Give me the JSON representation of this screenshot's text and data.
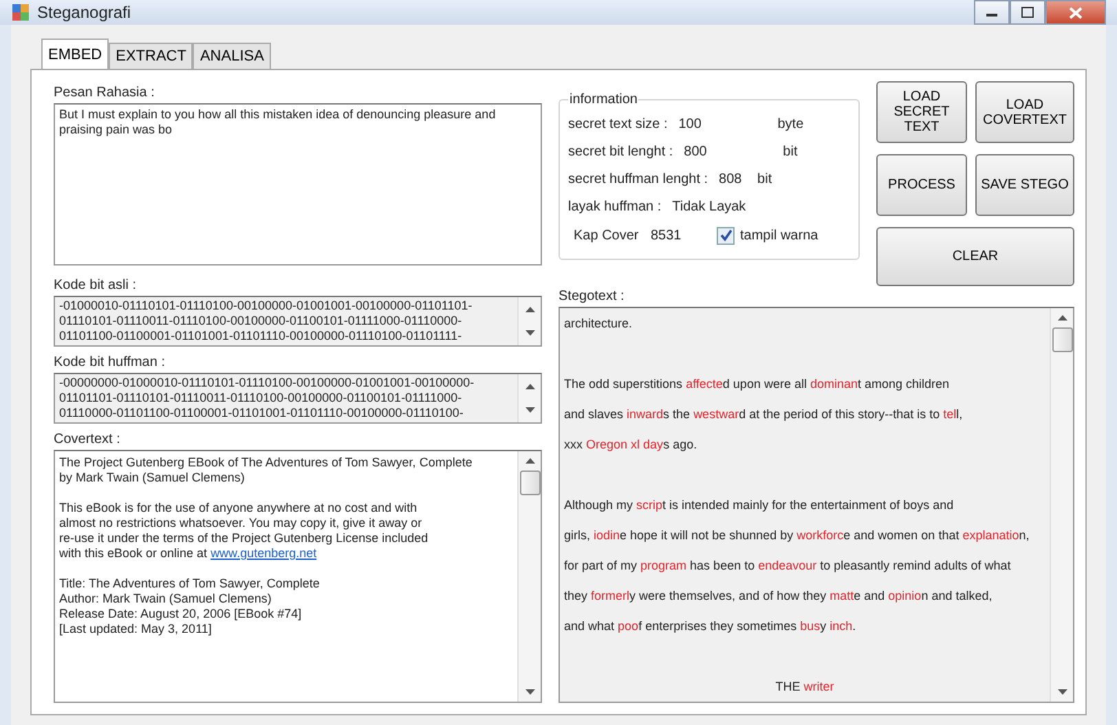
{
  "window": {
    "title": "Steganografi"
  },
  "tabs": [
    {
      "label": "EMBED",
      "selected": true
    },
    {
      "label": "EXTRACT",
      "selected": false
    },
    {
      "label": "ANALISA",
      "selected": false
    }
  ],
  "secret_message": {
    "label": "Pesan Rahasia :",
    "value": "But I must explain to you how all this mistaken idea of denouncing pleasure and praising pain was bo"
  },
  "original_bits": {
    "label": "Kode bit asli :",
    "lines": [
      "-01000010-01110101-01110100-00100000-01001001-00100000-01101101-",
      "01110101-01110011-01110100-00100000-01100101-01111000-01110000-",
      "01101100-01100001-01101001-01101110-00100000-01110100-01101111-"
    ]
  },
  "huffman_bits": {
    "label": "Kode bit huffman :",
    "lines": [
      "-00000000-01000010-01110101-01110100-00100000-01001001-00100000-",
      "01101101-01110101-01110011-01110100-00100000-01100101-01111000-",
      "01110000-01101100-01100001-01101001-01101110-00100000-01110100-"
    ]
  },
  "covertext": {
    "label": "Covertext :",
    "lines": [
      {
        "text": "The Project Gutenberg EBook of The Adventures of Tom Sawyer, Complete",
        "blank_before": false
      },
      {
        "text": "by Mark Twain (Samuel Clemens)",
        "blank_before": false
      },
      {
        "text": "This eBook is for the use of anyone anywhere at no cost and with",
        "blank_before": true
      },
      {
        "text": "almost no restrictions whatsoever.  You may copy it, give it away or",
        "blank_before": false
      },
      {
        "text": "re-use it under the terms of the Project Gutenberg License included",
        "blank_before": false
      },
      {
        "text": "with this eBook or online at ",
        "link": "www.gutenberg.net",
        "blank_before": false
      },
      {
        "text": "Title: The Adventures of Tom Sawyer, Complete",
        "blank_before": true
      },
      {
        "text": "Author: Mark Twain (Samuel Clemens)",
        "blank_before": false
      },
      {
        "text": "Release Date: August 20, 2006 [EBook #74]",
        "blank_before": false
      },
      {
        "text": "[Last updated: May 3, 2011]",
        "blank_before": false
      }
    ]
  },
  "information": {
    "title": "information",
    "rows": [
      {
        "label": "secret text size :",
        "value": "100",
        "unit": "byte"
      },
      {
        "label": "secret bit lenght :",
        "value": "800",
        "unit": "bit"
      },
      {
        "label": "secret huffman lenght :",
        "value": "808",
        "unit": "bit"
      },
      {
        "label": "layak huffman :",
        "value": "Tidak Layak"
      }
    ],
    "cover": {
      "label": "Kap Cover",
      "value": "8531"
    },
    "show_color": {
      "label": "tampil warna",
      "checked": true
    }
  },
  "buttons": [
    {
      "label": "LOAD SECRET TEXT"
    },
    {
      "label": "LOAD COVERTEXT"
    },
    {
      "label": "PROCESS"
    },
    {
      "label": "SAVE STEGO"
    },
    {
      "label": "CLEAR"
    }
  ],
  "stegotext": {
    "label": "Stegotext :",
    "lines": [
      {
        "blank_before": false,
        "kind": "text",
        "segments": [
          {
            "text": "architecture.",
            "colored": false
          }
        ]
      },
      {
        "blank_before": true,
        "kind": "text",
        "segments": [
          {
            "text": "The odd superstitions ",
            "colored": false
          },
          {
            "text": "affecte",
            "colored": true
          },
          {
            "text": "d upon were all ",
            "colored": false
          },
          {
            "text": "dominan",
            "colored": true
          },
          {
            "text": "t among children",
            "colored": false
          }
        ]
      },
      {
        "blank_before": false,
        "kind": "text",
        "segments": [
          {
            "text": "and slaves ",
            "colored": false
          },
          {
            "text": "inward",
            "colored": true
          },
          {
            "text": "s the ",
            "colored": false
          },
          {
            "text": "westwar",
            "colored": true
          },
          {
            "text": "d at the period of this story--that is to ",
            "colored": false
          },
          {
            "text": "tel",
            "colored": true
          },
          {
            "text": "l,",
            "colored": false
          }
        ]
      },
      {
        "blank_before": false,
        "kind": "text",
        "segments": [
          {
            "text": "xxx ",
            "colored": false
          },
          {
            "text": "Oregon ",
            "colored": true
          },
          {
            "text": "xl ",
            "colored": true
          },
          {
            "text": "day",
            "colored": true
          },
          {
            "text": "s ago.",
            "colored": false
          }
        ]
      },
      {
        "blank_before": true,
        "kind": "text",
        "segments": [
          {
            "text": "Although my ",
            "colored": false
          },
          {
            "text": "scrip",
            "colored": true
          },
          {
            "text": "t is intended mainly for the entertainment of boys and",
            "colored": false
          }
        ]
      },
      {
        "blank_before": false,
        "kind": "text",
        "segments": [
          {
            "text": "girls, ",
            "colored": false
          },
          {
            "text": "iodin",
            "colored": true
          },
          {
            "text": "e hope it will not be shunned by ",
            "colored": false
          },
          {
            "text": "workforc",
            "colored": true
          },
          {
            "text": "e and women on that ",
            "colored": false
          },
          {
            "text": "explanatio",
            "colored": true
          },
          {
            "text": "n,",
            "colored": false
          }
        ]
      },
      {
        "blank_before": false,
        "kind": "text",
        "segments": [
          {
            "text": "for part of my ",
            "colored": false
          },
          {
            "text": "program",
            "colored": true
          },
          {
            "text": " has been to ",
            "colored": false
          },
          {
            "text": "endeavour",
            "colored": true
          },
          {
            "text": " to pleasantly remind adults of what",
            "colored": false
          }
        ]
      },
      {
        "blank_before": false,
        "kind": "text",
        "segments": [
          {
            "text": "they ",
            "colored": false
          },
          {
            "text": "formerl",
            "colored": true
          },
          {
            "text": "y were themselves, and of how they ",
            "colored": false
          },
          {
            "text": "matt",
            "colored": true
          },
          {
            "text": "e and ",
            "colored": false
          },
          {
            "text": "opinio",
            "colored": true
          },
          {
            "text": "n and talked,",
            "colored": false
          }
        ]
      },
      {
        "blank_before": false,
        "kind": "text",
        "segments": [
          {
            "text": "and what ",
            "colored": false
          },
          {
            "text": "poo",
            "colored": true
          },
          {
            "text": "f enterprises they sometimes ",
            "colored": false
          },
          {
            "text": "bus",
            "colored": true
          },
          {
            "text": "y ",
            "colored": false
          },
          {
            "text": "inch",
            "colored": true
          },
          {
            "text": ".",
            "colored": false
          }
        ]
      },
      {
        "blank_before": true,
        "kind": "heading",
        "segments": [
          {
            "text": "THE ",
            "colored": false
          },
          {
            "text": "writer",
            "colored": true
          }
        ]
      }
    ]
  }
}
